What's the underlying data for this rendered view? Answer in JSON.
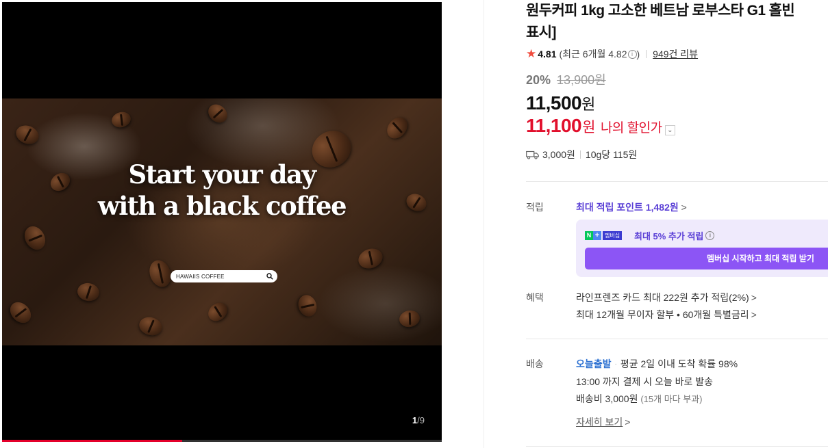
{
  "viewer": {
    "headline_line1": "Start your day",
    "headline_line2": "with a black coffee",
    "search_text": "HAWAIIS COFFEE",
    "counter_current": "1",
    "counter_total": "/9",
    "progress": 0.41,
    "accent": "#e4002b"
  },
  "product": {
    "title_line1": "원두커피 1kg 고소한 베트남 로부스타 G1 홀빈",
    "title_line2": "표시]",
    "rating": "4.81",
    "rating_recent": "(최근 6개월 4.82",
    "rating_close": ")",
    "info_glyph": "i",
    "reviews": "949건 리뷰",
    "discount_pct": "20%",
    "original_price": "13,900원",
    "price": "11,500",
    "price_unit": "원",
    "my_price": "11,100",
    "my_price_unit": "원",
    "my_price_label": "나의 할인가",
    "shipping_fee": "3,000원",
    "unit_price": "10g당 115원"
  },
  "points": {
    "label": "적립",
    "max_text": "최대 적립 포인트",
    "max_value": "1,482원",
    "arrow": ">",
    "badge_n": "N",
    "badge_plus": "+",
    "badge_member": "멤버십",
    "member_text": "최대 5% 추가 적립",
    "member_button": "멤버십 시작하고 최대 적립 받기"
  },
  "benefits": {
    "label": "혜택",
    "card": "라인프렌즈 카드 최대 222원 추가 적립(2%)",
    "installment": "최대 12개월 무이자 할부 • 60개월 특별금리"
  },
  "delivery": {
    "label": "배송",
    "today": "오늘출발",
    "separator": "·",
    "probability": "평균 2일 이내 도착 확률 98%",
    "cutoff": "13:00 까지 결제 시 오늘 바로 발송",
    "fee": "배송비 3,000원",
    "fee_note": "(15개 마다 부과)",
    "detail_link": "자세히 보기"
  },
  "colors": {
    "sale_red": "#e10f2c",
    "point_purple": "#5a3fd6",
    "member_button": "#8c55f5",
    "today_blue": "#2e72d2",
    "star": "#f04c3e"
  }
}
